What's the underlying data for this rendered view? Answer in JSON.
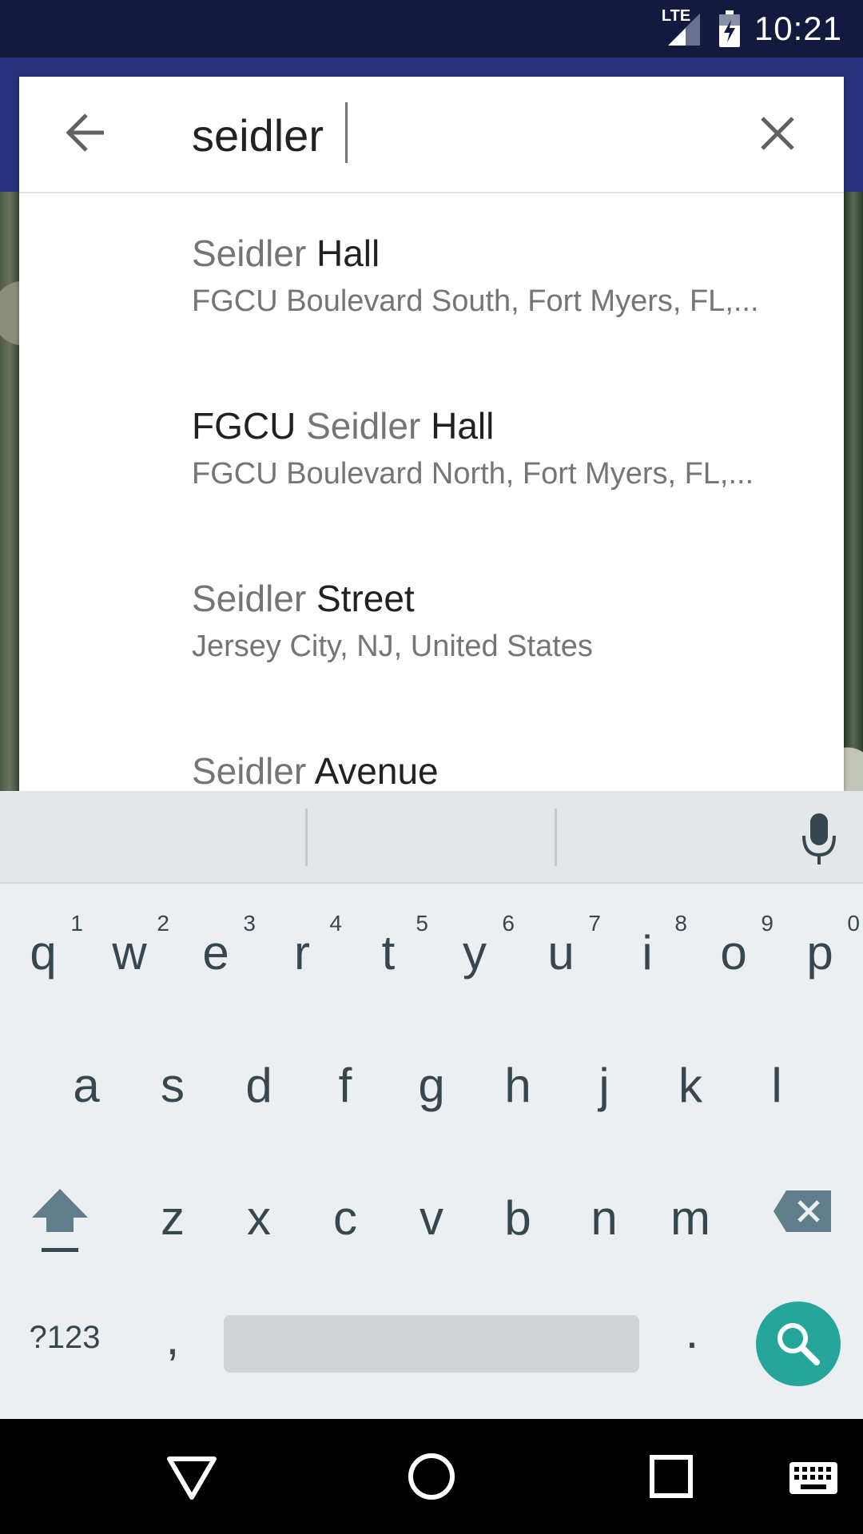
{
  "status_bar": {
    "time": "10:21",
    "network_label": "LTE",
    "icons": [
      "lte-signal-icon",
      "battery-charging-icon"
    ]
  },
  "search": {
    "query": "seidler",
    "back_icon": "arrow-back-icon",
    "clear_icon": "close-icon"
  },
  "suggestions": [
    {
      "title_muted": "Seidler",
      "title_strong": "Hall",
      "title_prefix": "",
      "subtitle": "FGCU Boulevard South, Fort Myers, FL,..."
    },
    {
      "title_prefix": "FGCU",
      "title_muted": "Seidler",
      "title_strong": "Hall",
      "subtitle": "FGCU Boulevard North, Fort Myers, FL,..."
    },
    {
      "title_muted": "Seidler",
      "title_strong": "Street",
      "title_prefix": "",
      "subtitle": "Jersey City, NJ, United States"
    },
    {
      "title_muted": "Seidler",
      "title_strong": "Avenue",
      "title_prefix": "",
      "subtitle": ""
    }
  ],
  "keyboard": {
    "row1": [
      "q",
      "w",
      "e",
      "r",
      "t",
      "y",
      "u",
      "i",
      "o",
      "p"
    ],
    "row1_hints": [
      "1",
      "2",
      "3",
      "4",
      "5",
      "6",
      "7",
      "8",
      "9",
      "0"
    ],
    "row2": [
      "a",
      "s",
      "d",
      "f",
      "g",
      "h",
      "j",
      "k",
      "l"
    ],
    "row3": [
      "z",
      "x",
      "c",
      "v",
      "b",
      "n",
      "m"
    ],
    "symbols_label": "?123",
    "comma": ",",
    "period": ".",
    "icons": [
      "shift-icon",
      "backspace-icon",
      "microphone-icon",
      "search-icon"
    ],
    "accent_color": "#26a69a"
  },
  "nav_bar": {
    "icons": [
      "back-triangle-icon",
      "home-circle-icon",
      "recents-square-icon",
      "keyboard-icon"
    ]
  }
}
